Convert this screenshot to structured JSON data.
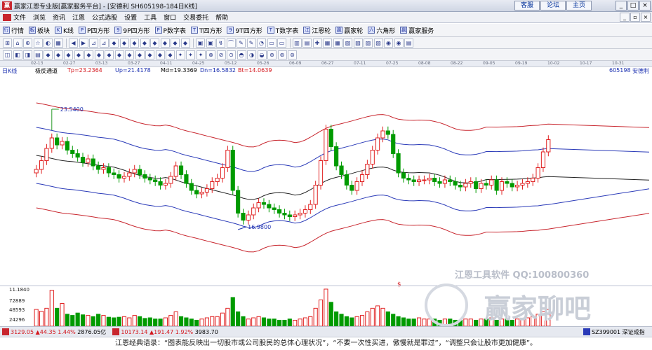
{
  "window": {
    "title": "赢家江恩专业版[赢家服务平台] - [安德利  SH605198-184日K线]",
    "links": [
      "客服",
      "论坛",
      "主页"
    ]
  },
  "menu": [
    "文件",
    "浏览",
    "资讯",
    "江恩",
    "公式选股",
    "设置",
    "工具",
    "窗口",
    "交易委托",
    "帮助"
  ],
  "toolbar1": [
    {
      "icon": "行",
      "label": "行情"
    },
    {
      "icon": "板",
      "label": "板块"
    },
    {
      "icon": "K",
      "label": "K线"
    },
    {
      "icon": "P",
      "label": "P四方形"
    },
    {
      "icon": "9",
      "label": "9P四方形"
    },
    {
      "icon": "P",
      "label": "P数字表"
    },
    {
      "icon": "T",
      "label": "T四方形"
    },
    {
      "icon": "9",
      "label": "9T四方形"
    },
    {
      "icon": "T",
      "label": "T数字表"
    },
    {
      "icon": "江",
      "label": "江恩轮"
    },
    {
      "icon": "赢",
      "label": "赢家轮"
    },
    {
      "icon": "六",
      "label": "六角形"
    },
    {
      "icon": "赢",
      "label": "赢家服务"
    }
  ],
  "dates": [
    "02-13",
    "02-27",
    "03-13",
    "03-27",
    "04-11",
    "04-25",
    "05-12",
    "05-26",
    "06-09",
    "06-27",
    "07-11",
    "07-25",
    "08-08",
    "08-22",
    "09-05",
    "09-19",
    "10-02",
    "10-17",
    "10-31"
  ],
  "info": {
    "period": "日K线",
    "indicator": "极反通道",
    "tp": "Tp=23.2364",
    "up": "Up=21.4178",
    "md": "Md=19.3369",
    "dn": "Dn=16.5832",
    "bt": "Bt=14.0639",
    "code": "605198",
    "name": "安德利"
  },
  "annotations": {
    "high": "23.5400",
    "low": "16.9800",
    "dollar": "$"
  },
  "volume_axis": [
    "11.1840",
    "72889",
    "48593",
    "24296"
  ],
  "watermark": {
    "line1": "江恩工具软件  QQ:100800360",
    "line2": "赢家聊吧"
  },
  "status": {
    "sh": {
      "index": "3129.05",
      "chg": "▲44.35",
      "pct": "1.44%",
      "amt": "2876.05亿"
    },
    "sz": {
      "index": "10173.14",
      "chg": "▲191.47",
      "pct": "1.92%",
      "amt": "3983.70"
    },
    "right": "SZ399001 深证成指"
  },
  "quote": "江恩经典语录：“图表能反映出一切股市或公司股民的总体心理状况”，“不要一次性买进，傲慢就是罪过”，“调整只会让股市更加健康”。",
  "colors": {
    "up": "#e02020",
    "down": "#009a00",
    "upper_band": "#c8262e",
    "mid_band": "#2a3ab8",
    "middle": "#222222"
  },
  "chart_data": {
    "type": "candlestick",
    "title": "极反通道",
    "series": [
      {
        "name": "Tp",
        "value": 23.2364
      },
      {
        "name": "Up",
        "value": 21.4178
      },
      {
        "name": "Md",
        "value": 19.3369
      },
      {
        "name": "Dn",
        "value": 16.5832
      },
      {
        "name": "Bt",
        "value": 14.0639
      }
    ],
    "labeled_high": 23.54,
    "labeled_low": 16.98,
    "closes": [
      20.1,
      20.6,
      21.3,
      21.9,
      21.5,
      21.7,
      21.2,
      21.0,
      20.8,
      20.5,
      20.7,
      20.3,
      20.1,
      20.2,
      19.9,
      19.8,
      19.6,
      19.7,
      19.9,
      20.1,
      19.8,
      19.6,
      19.5,
      19.4,
      19.2,
      19.3,
      19.7,
      20.3,
      19.8,
      19.3,
      18.9,
      18.7,
      18.8,
      19.0,
      19.4,
      19.6,
      20.2,
      21.2,
      18.9,
      17.6,
      17.2,
      17.5,
      17.9,
      18.2,
      18.1,
      17.9,
      17.8,
      17.6,
      17.5,
      17.4,
      17.5,
      17.6,
      17.8,
      18.1,
      19.2,
      20.6,
      22.4,
      21.4,
      20.3,
      19.8,
      19.2,
      18.9,
      19.4,
      19.8,
      20.4,
      21.2,
      21.9,
      22.3,
      22.1,
      21.0,
      19.9,
      19.6,
      19.5,
      19.4,
      19.5,
      19.5,
      19.6,
      19.4,
      19.3,
      19.5,
      19.4,
      19.2,
      19.1,
      19.3,
      19.4,
      19.0,
      19.3,
      19.2,
      19.5,
      18.9,
      19.4,
      19.3,
      19.1,
      19.2,
      19.3,
      19.4,
      19.6,
      20.2,
      21.1,
      21.8
    ],
    "volumes": [
      28,
      25,
      30,
      60,
      30,
      38,
      20,
      18,
      22,
      19,
      18,
      16,
      20,
      18,
      15,
      14,
      15,
      16,
      14,
      18,
      16,
      13,
      14,
      12,
      12,
      14,
      18,
      24,
      16,
      14,
      12,
      10,
      12,
      14,
      16,
      16,
      22,
      30,
      48,
      24,
      16,
      12,
      14,
      16,
      14,
      12,
      12,
      10,
      10,
      12,
      10,
      12,
      14,
      16,
      30,
      44,
      62,
      40,
      24,
      20,
      16,
      14,
      16,
      18,
      24,
      30,
      34,
      30,
      24,
      20,
      16,
      14,
      12,
      12,
      14,
      12,
      12,
      12,
      10,
      12,
      12,
      10,
      10,
      12,
      12,
      10,
      12,
      12,
      14,
      10,
      12,
      12,
      10,
      12,
      12,
      14,
      16,
      20,
      24,
      28
    ]
  }
}
